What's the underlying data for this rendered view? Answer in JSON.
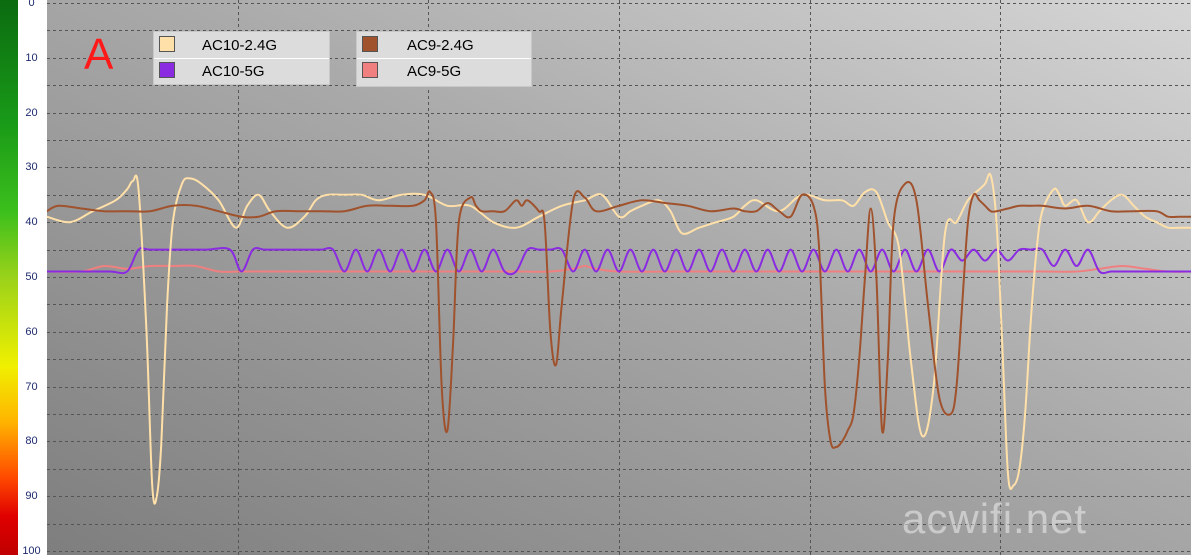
{
  "chart_data": {
    "type": "line",
    "title": "",
    "xlabel": "",
    "ylabel": "",
    "ylim": [
      0,
      100
    ],
    "y_inverted": true,
    "xlim": [
      0,
      100
    ],
    "y_ticks": [
      "0",
      "10",
      "20",
      "30",
      "40",
      "50",
      "60",
      "70",
      "80",
      "90",
      "100"
    ],
    "grid": true,
    "legend_position": "top-left",
    "annotation": "A",
    "watermark": "acwifi.net",
    "series": [
      {
        "name": "AC10-2.4G",
        "color": "#ffe0a8",
        "x": [
          0,
          2,
          4,
          6,
          7,
          7.5,
          8,
          8.7,
          9.2,
          9.6,
          10,
          10.5,
          11,
          11.8,
          12.5,
          13.5,
          15,
          16.5,
          17.5,
          18.5,
          19.5,
          21,
          22.5,
          23.5,
          24.5,
          26,
          27.5,
          29,
          31,
          33,
          35,
          37,
          39,
          41,
          43,
          45,
          47,
          48.5,
          50,
          51,
          52,
          53.5,
          54.5,
          55.5,
          57,
          58.5,
          60,
          61,
          62,
          64,
          66,
          68,
          69.5,
          70.5,
          71.5,
          72.5,
          73.5,
          74.5,
          75.5,
          76.5,
          77.5,
          78.5,
          79.5,
          80.5,
          81.5,
          82,
          82.5,
          83,
          83.5,
          84,
          84.5,
          85,
          85.5,
          86,
          86.5,
          87,
          88,
          88.5,
          89,
          90,
          91,
          92,
          93,
          94,
          95,
          96,
          97,
          98,
          99,
          100
        ],
        "values": [
          39,
          40,
          38,
          36,
          34,
          32.5,
          34,
          60,
          88,
          90,
          80,
          55,
          40,
          33,
          32,
          33,
          36,
          41,
          37,
          35,
          38,
          41,
          39,
          36,
          35,
          35,
          35,
          36,
          35,
          35,
          37,
          37,
          40,
          41,
          39,
          37,
          36,
          35,
          39,
          38,
          37,
          36,
          38,
          42,
          41,
          40,
          39,
          37,
          36,
          38,
          35,
          36,
          36,
          37,
          34.5,
          34.5,
          40,
          45,
          65,
          79,
          70,
          42,
          40,
          36,
          34,
          33,
          31.5,
          40,
          62,
          86,
          88,
          85,
          75,
          58,
          45,
          38,
          34,
          35,
          37,
          36,
          40,
          38,
          36,
          35,
          37,
          39,
          40,
          41,
          41,
          41
        ]
      },
      {
        "name": "AC10-5G",
        "color": "#8a2be2",
        "x": [
          0,
          3,
          5.5,
          7,
          8,
          9,
          12,
          14,
          16,
          17,
          18,
          19,
          20,
          21,
          22,
          23,
          24,
          25,
          26,
          27,
          28,
          29,
          30,
          31,
          32,
          33,
          34,
          35,
          36,
          37,
          38,
          39,
          40,
          41,
          42,
          43,
          44,
          45,
          46,
          47,
          48,
          49,
          50,
          51,
          52,
          53,
          54,
          55,
          56,
          57,
          58,
          59,
          60,
          61,
          62,
          63,
          64,
          65,
          66,
          67,
          68,
          69,
          70,
          71,
          72,
          73,
          74,
          75,
          76,
          77,
          78,
          79,
          80,
          81,
          82,
          83,
          84,
          85,
          86,
          87,
          88,
          89,
          90,
          91,
          92,
          93,
          94,
          95,
          96,
          97,
          98,
          100
        ],
        "values": [
          49,
          49,
          49,
          49,
          45,
          45,
          45,
          45,
          45,
          49,
          45,
          45,
          45,
          45,
          45,
          45,
          45,
          45,
          49,
          45,
          49,
          45,
          49,
          45,
          49,
          45,
          49,
          45,
          49,
          45,
          49,
          45,
          49,
          49,
          45,
          45,
          45,
          45,
          49,
          45,
          49,
          45,
          49,
          45,
          49,
          45,
          49,
          45,
          49,
          45,
          49,
          45,
          49,
          45,
          49,
          45,
          49,
          45,
          49,
          45,
          49,
          45,
          49,
          45,
          49,
          45,
          49,
          45,
          49,
          45,
          49,
          45,
          47,
          45,
          47,
          45,
          47,
          45,
          45,
          45,
          48,
          45,
          48,
          45,
          49,
          49,
          49,
          49,
          49,
          49,
          49,
          49
        ]
      },
      {
        "name": "AC9-2.4G",
        "color": "#a0522d",
        "x": [
          0,
          1,
          3,
          5,
          7,
          9,
          11,
          13,
          15,
          17,
          18.5,
          20,
          22,
          24,
          26,
          28,
          30,
          32,
          33,
          33.5,
          34,
          34.5,
          35,
          35.5,
          36,
          37,
          37.5,
          38,
          39,
          40,
          41,
          41.5,
          42,
          43,
          43.5,
          44,
          44.5,
          45,
          46,
          47,
          48,
          50,
          52,
          54,
          56,
          58,
          60,
          61,
          62,
          63,
          64,
          65,
          66,
          67,
          67.5,
          68,
          68.5,
          69,
          69.5,
          70,
          70.5,
          71,
          71.5,
          72,
          72.5,
          73,
          73.5,
          74,
          75,
          76,
          77,
          78,
          79,
          79.5,
          80,
          80.5,
          81,
          81.5,
          82,
          82.5,
          83,
          84,
          85,
          86,
          87,
          89,
          91,
          93,
          95,
          97,
          98,
          99,
          100
        ],
        "values": [
          38,
          37,
          37.5,
          38,
          38,
          38,
          37,
          37,
          38,
          39,
          39,
          38,
          38,
          38,
          38,
          37,
          37,
          37,
          36,
          34.5,
          40,
          70,
          78,
          62,
          40,
          35.5,
          37,
          38,
          38,
          38,
          36,
          37,
          36,
          38,
          40,
          60,
          66,
          55,
          36,
          35.5,
          38,
          37,
          36,
          36.5,
          37,
          38,
          37.5,
          38,
          38,
          36.5,
          38,
          39,
          35,
          37,
          45,
          70,
          80,
          81,
          80,
          78,
          75,
          65,
          50,
          37.5,
          50,
          78,
          65,
          40,
          33,
          36,
          55,
          72,
          75,
          70,
          55,
          40,
          35,
          36,
          37,
          38,
          38,
          37.5,
          37,
          37,
          37,
          37.5,
          37,
          38,
          38,
          38,
          39,
          39,
          39
        ]
      },
      {
        "name": "AC9-5G",
        "color": "#f08080",
        "x": [
          0,
          3,
          5,
          7,
          9,
          11,
          13,
          15,
          17,
          20,
          25,
          30,
          35,
          38,
          41,
          44,
          46,
          47,
          48,
          50,
          55,
          60,
          65,
          70,
          75,
          80,
          84,
          87,
          90,
          92,
          94,
          96,
          98,
          100
        ],
        "values": [
          49,
          49,
          48,
          48.5,
          48,
          48,
          48,
          49,
          49,
          49,
          49,
          49,
          49,
          49,
          49,
          49,
          48.5,
          48,
          48.5,
          49,
          49,
          49,
          49,
          49,
          49,
          49,
          49,
          49,
          49,
          48.5,
          48,
          48.5,
          49,
          49
        ]
      }
    ]
  }
}
